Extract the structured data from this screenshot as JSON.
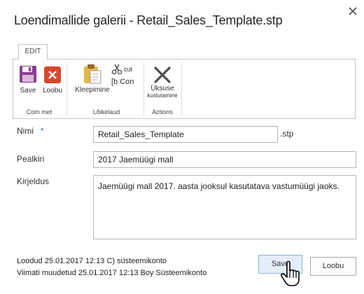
{
  "dialog": {
    "title": "Loendimallide galerii - Retail_Sales_Template.stp"
  },
  "ribbon": {
    "tab_label": "EDIT",
    "groups": [
      {
        "label": "Com met",
        "buttons": [
          {
            "label": "Save",
            "icon": "save-icon",
            "color": "#8a3d8f"
          },
          {
            "label": "Loobu",
            "icon": "cancel-icon",
            "color": "#d9472b"
          }
        ]
      },
      {
        "label": "Lõikelaud",
        "buttons": [
          {
            "label": "Kleepimine",
            "icon": "paste-icon"
          },
          {
            "label": "cut",
            "icon": "scissors-icon"
          },
          {
            "label": "[b Con",
            "icon": "copy-icon"
          }
        ]
      },
      {
        "label": "Actions",
        "buttons": [
          {
            "label_line1": "Üksuse",
            "label_line2": "kustutamine",
            "icon": "delete-x-icon"
          }
        ]
      }
    ]
  },
  "form": {
    "name": {
      "label": "Nimi",
      "required_mark": "*",
      "value": "Retail_Sales_Template",
      "suffix": ".stp"
    },
    "title": {
      "label": "Pealkiri",
      "value": "2017 Jaemüügi mall"
    },
    "description": {
      "label": "Kirjeldus",
      "value": "Jaemüügi mall 2017. aasta jooksul kasutatava vastumüügi jaoks."
    }
  },
  "footer": {
    "created": "Loodud 25.01.2017 12:13 C) süsteemikonto",
    "modified": "Viimati muudetud 25.01.2017 12:13 Boy Süsteemikonto",
    "save_label": "Save",
    "cancel_label": "Loobu"
  }
}
